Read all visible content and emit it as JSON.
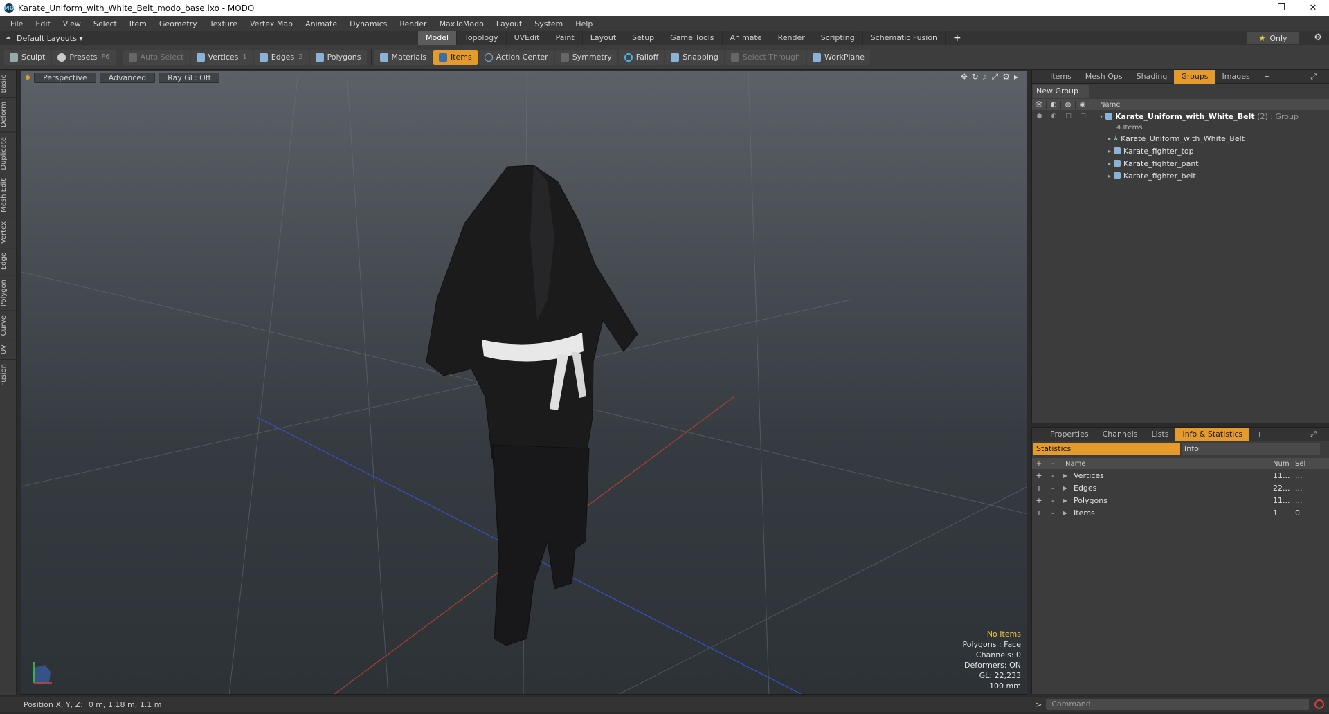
{
  "window": {
    "title": "Karate_Uniform_with_White_Belt_modo_base.lxo - MODO",
    "app_icon": "MO",
    "minimize": "—",
    "maximize": "❐",
    "close": "✕"
  },
  "menu": [
    "File",
    "Edit",
    "View",
    "Select",
    "Item",
    "Geometry",
    "Texture",
    "Vertex Map",
    "Animate",
    "Dynamics",
    "Render",
    "MaxToModo",
    "Layout",
    "System",
    "Help"
  ],
  "layout": {
    "dropdown": "Default Layouts ▾",
    "tabs": [
      "Model",
      "Topology",
      "UVEdit",
      "Paint",
      "Layout",
      "Setup",
      "Game Tools",
      "Animate",
      "Render",
      "Scripting",
      "Schematic Fusion"
    ],
    "active_tab": "Model",
    "add": "+",
    "only_star": "★",
    "only_label": "Only"
  },
  "toolbar": {
    "sculpt": "Sculpt",
    "presets": "Presets",
    "presets_key": "F6",
    "auto_select": "Auto Select",
    "vertices": "Vertices",
    "vertices_key": "1",
    "edges": "Edges",
    "edges_key": "2",
    "polygons": "Polygons",
    "materials": "Materials",
    "items": "Items",
    "action_center": "Action Center",
    "symmetry": "Symmetry",
    "falloff": "Falloff",
    "snapping": "Snapping",
    "select_through": "Select Through",
    "workplane": "WorkPlane"
  },
  "left_tabs": [
    "Basic",
    "Deform",
    "Duplicate",
    "Mesh Edit",
    "Vertex",
    "Edge",
    "Polygon",
    "Curve",
    "UV",
    "Fusion"
  ],
  "viewport": {
    "perspective": "Perspective",
    "advanced": "Advanced",
    "raygl": "Ray GL: Off",
    "info": {
      "no_items": "No Items",
      "polygons": "Polygons : Face",
      "channels": "Channels: 0",
      "deformers": "Deformers: ON",
      "gl": "GL: 22,233",
      "scale": "100 mm"
    }
  },
  "status": {
    "label": "Position X, Y, Z:",
    "value": "0 m, 1.18 m, 1.1 m"
  },
  "top_panel": {
    "tabs": [
      "Items",
      "Mesh Ops",
      "Shading",
      "Groups",
      "Images"
    ],
    "active": "Groups",
    "new_group": "New Group",
    "name_header": "Name",
    "group": {
      "name": "Karate_Uniform_with_White_Belt",
      "suffix": "(2) : Group",
      "count": "4 Items",
      "children": [
        "Karate_Uniform_with_White_Belt",
        "Karate_fighter_top",
        "Karate_fighter_pant",
        "Karate_fighter_belt"
      ]
    }
  },
  "bottom_panel": {
    "tabs": [
      "Properties",
      "Channels",
      "Lists",
      "Info & Statistics"
    ],
    "active": "Info & Statistics",
    "statistics": "Statistics",
    "info": "Info",
    "headers": {
      "name": "Name",
      "num": "Num",
      "sel": "Sel"
    },
    "rows": [
      {
        "name": "Vertices",
        "num": "11...",
        "sel": "..."
      },
      {
        "name": "Edges",
        "num": "22...",
        "sel": "..."
      },
      {
        "name": "Polygons",
        "num": "11...",
        "sel": "..."
      },
      {
        "name": "Items",
        "num": "1",
        "sel": "0"
      }
    ]
  },
  "command": {
    "prompt": ">",
    "placeholder": "Command"
  }
}
